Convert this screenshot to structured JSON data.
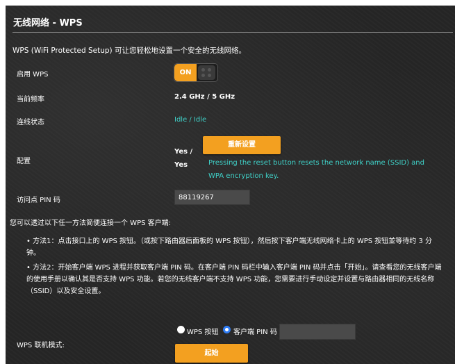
{
  "title": "无线网络 - WPS",
  "intro": "WPS (WiFi Protected Setup) 可让您轻松地设置一个安全的无线网络。",
  "rows": {
    "enable_label": "启用 WPS",
    "toggle_on": "ON",
    "band_label": "当前频率",
    "band_value": "2.4 GHz / 5 GHz",
    "status_label": "连线状态",
    "status_value": "Idle / Idle",
    "config_label": "配置",
    "config_value_line1": "Yes /",
    "config_value_line2": "Yes",
    "reset_button": "重新设置",
    "reset_desc": "Pressing the reset button resets the network name (SSID) and WPA encryption key.",
    "ap_pin_label": "访问点 PIN 码",
    "ap_pin_value": "88119267"
  },
  "methods": {
    "intro": "您可以透过以下任一方法简便连接一个 WPS 客户端:",
    "method1": "• 方法1：点击接口上的 WPS 按钮。（或按下路由器后面板的 WPS 按钮），然后按下客户端无线网络卡上的 WPS 按钮並等待约 3 分钟。",
    "method2": "• 方法2：开始客户端 WPS 进程并获取客户端 PIN 码。在客户端 PIN 码栏中输入客户端 PIN 码并点击「开始」。请查看您的无线客户端的使用手册以确认其是否支持 WPS 功能。若您的无线客户端不支持 WPS 功能，您需要进行手动设定并设置与路由器相同的无线名称（SSID）以及安全设置。"
  },
  "wps_mode": {
    "label": "WPS 联机模式:",
    "option_button": "WPS 按钮",
    "option_pin": "客户端 PIN 码",
    "selected": "客户端 PIN 码",
    "pin_value": "",
    "start_button": "起始"
  },
  "colors": {
    "accent": "#f3a020",
    "teal": "#3fd1c8",
    "panel_bg": "#262626",
    "radio_selected": "#2f7df5"
  }
}
